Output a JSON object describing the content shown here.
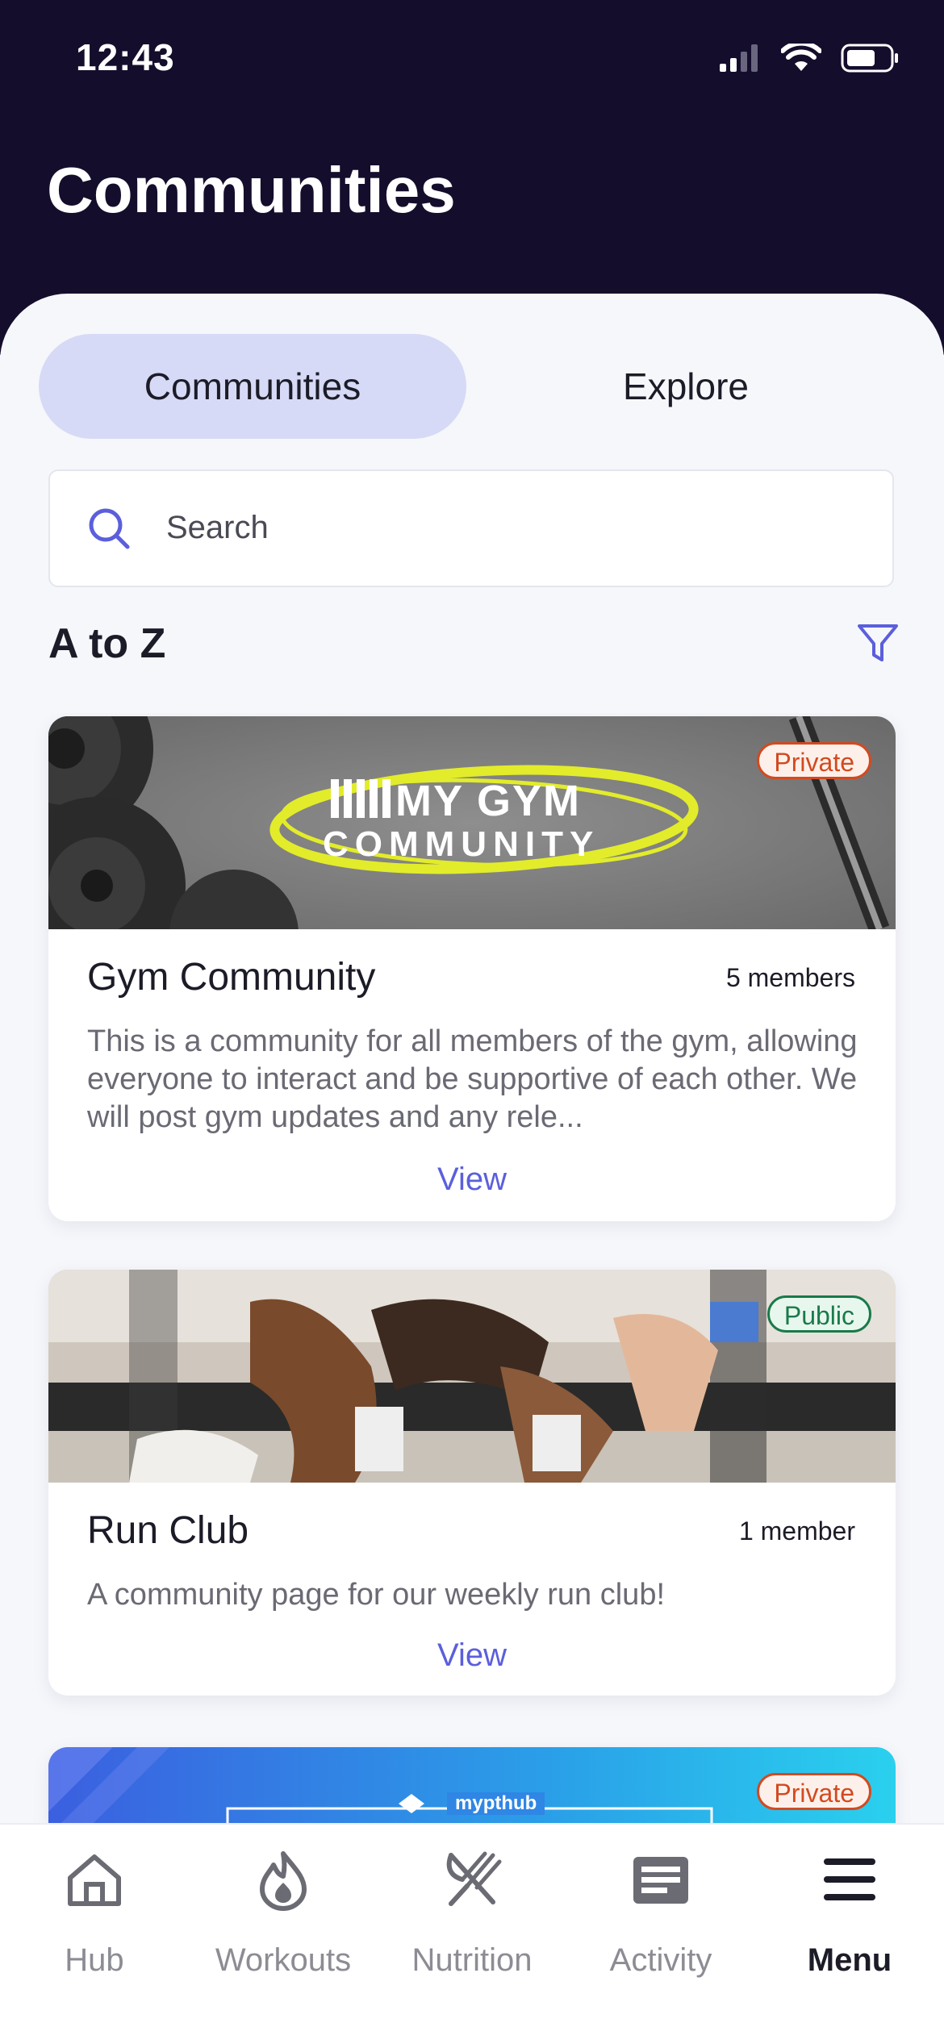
{
  "status": {
    "time": "12:43"
  },
  "header": {
    "title": "Communities"
  },
  "segments": {
    "communities": "Communities",
    "explore": "Explore"
  },
  "search": {
    "placeholder": "Search"
  },
  "section": {
    "title": "A to Z"
  },
  "cards": [
    {
      "banner_text_line1": "MY GYM",
      "banner_text_line2": "COMMUNITY",
      "badge": "Private",
      "title": "Gym Community",
      "members": "5 members",
      "description": "This is a community for all members of the gym, allowing everyone to interact and be supportive of each other. We will post gym updates and any rele...",
      "view": "View"
    },
    {
      "badge": "Public",
      "title": "Run Club",
      "members": "1 member",
      "description": "A community page for our weekly run club!",
      "view": "View"
    },
    {
      "badge": "Private",
      "banner_text": "mypthub"
    }
  ],
  "tabbar": {
    "hub": "Hub",
    "workouts": "Workouts",
    "nutrition": "Nutrition",
    "activity": "Activity",
    "menu": "Menu"
  },
  "colors": {
    "header_bg": "#150d2c",
    "accent": "#5b5fdc",
    "segment_active": "#d7daf6",
    "private": "#d24a1f",
    "public": "#1a7a4a"
  }
}
